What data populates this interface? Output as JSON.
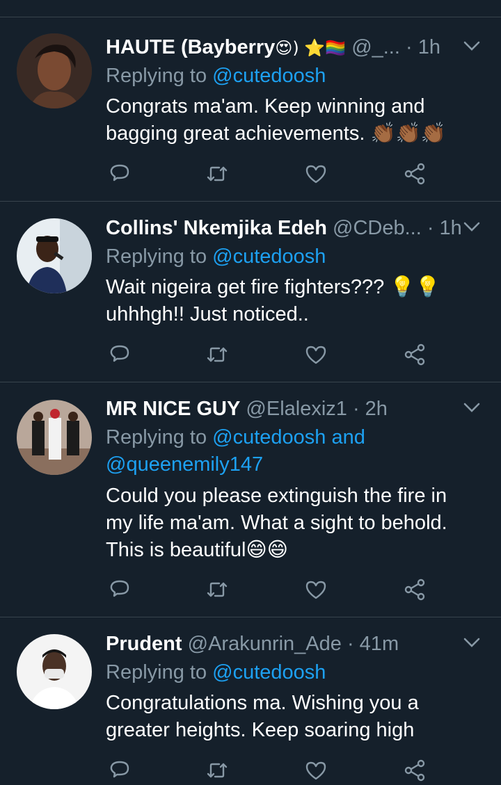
{
  "colors": {
    "background": "#15202b",
    "muted": "#8899a6",
    "link": "#1da1f2",
    "divider": "#38444d"
  },
  "tweets": [
    {
      "name": "HAUTE (Bayberry",
      "name_emoji": "😍) ⭐🏳‍🌈",
      "handle": "@_...",
      "time": "· 1h",
      "replying_prefix": "Replying to ",
      "replying_to": "@cutedoosh",
      "body_lines": [
        "Congrats ma'am. Keep winning and",
        "bagging great achievements. 👏🏾👏🏾👏🏾"
      ]
    },
    {
      "name": "Collins' Nkemjika Edeh",
      "handle": "@CDeb...",
      "time": "· 1h",
      "replying_prefix": "Replying to ",
      "replying_to": "@cutedoosh",
      "body_lines": [
        "Wait nigeira get fire fighters??? 💡💡",
        "uhhhgh!! Just noticed.."
      ]
    },
    {
      "name": "MR NICE GUY",
      "handle": "@Elalexiz1",
      "time": "· 2h",
      "replying_prefix": "Replying to ",
      "replying_to": "@cutedoosh and",
      "replying_to_2": "@queenemily147",
      "body_lines": [
        "Could you please extinguish the fire in",
        "my life ma'am. What a sight to behold.",
        "This is beautiful😄😄"
      ]
    },
    {
      "name": "Prudent",
      "handle": "@Arakunrin_Ade",
      "time": "· 41m",
      "replying_prefix": "Replying to ",
      "replying_to": "@cutedoosh",
      "body_lines": [
        "Congratulations ma. Wishing you a",
        "greater heights. Keep soaring high"
      ]
    }
  ],
  "icons": {
    "reply": "reply-icon",
    "retweet": "retweet-icon",
    "like": "heart-icon",
    "share": "share-icon",
    "menu": "chevron-down-icon"
  }
}
